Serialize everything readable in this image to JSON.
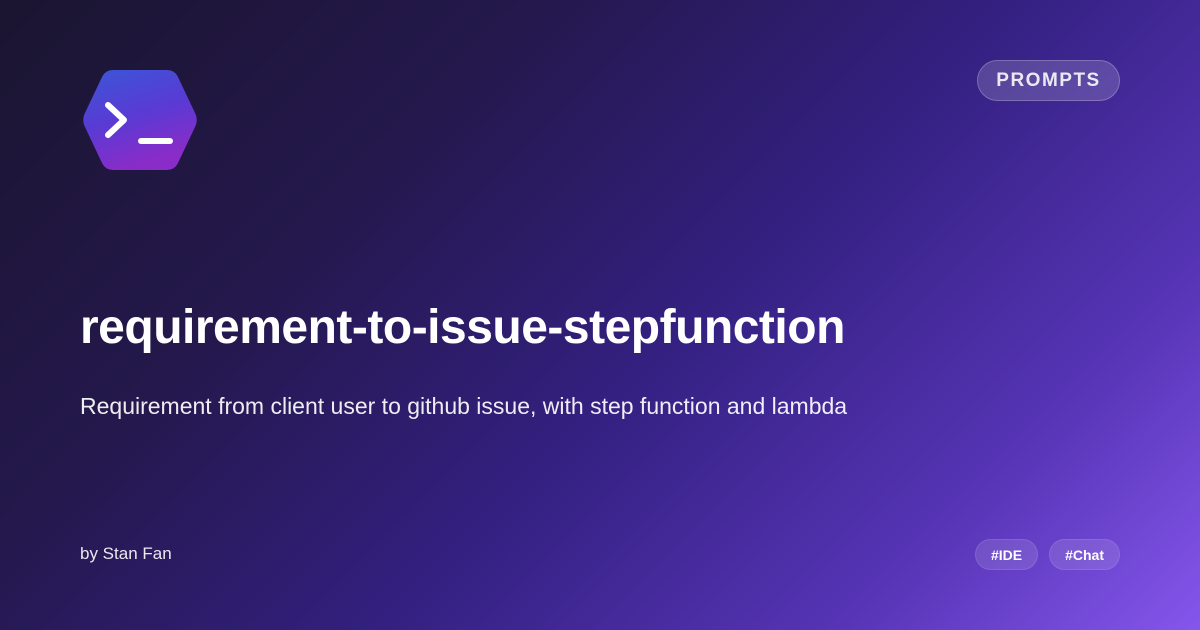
{
  "logo": {
    "icon": "terminal-prompt-icon",
    "colors": [
      "#3b56d6",
      "#7a2fd0"
    ]
  },
  "badge": {
    "label": "PROMPTS"
  },
  "title": "requirement-to-issue-stepfunction",
  "description": "Requirement from client user to github issue, with step function and lambda",
  "author": "by Stan Fan",
  "tags": [
    {
      "label": "#IDE"
    },
    {
      "label": "#Chat"
    }
  ],
  "colors": {
    "background_start": "#1b1530",
    "background_end": "#8556ec",
    "text": "#ffffff"
  }
}
